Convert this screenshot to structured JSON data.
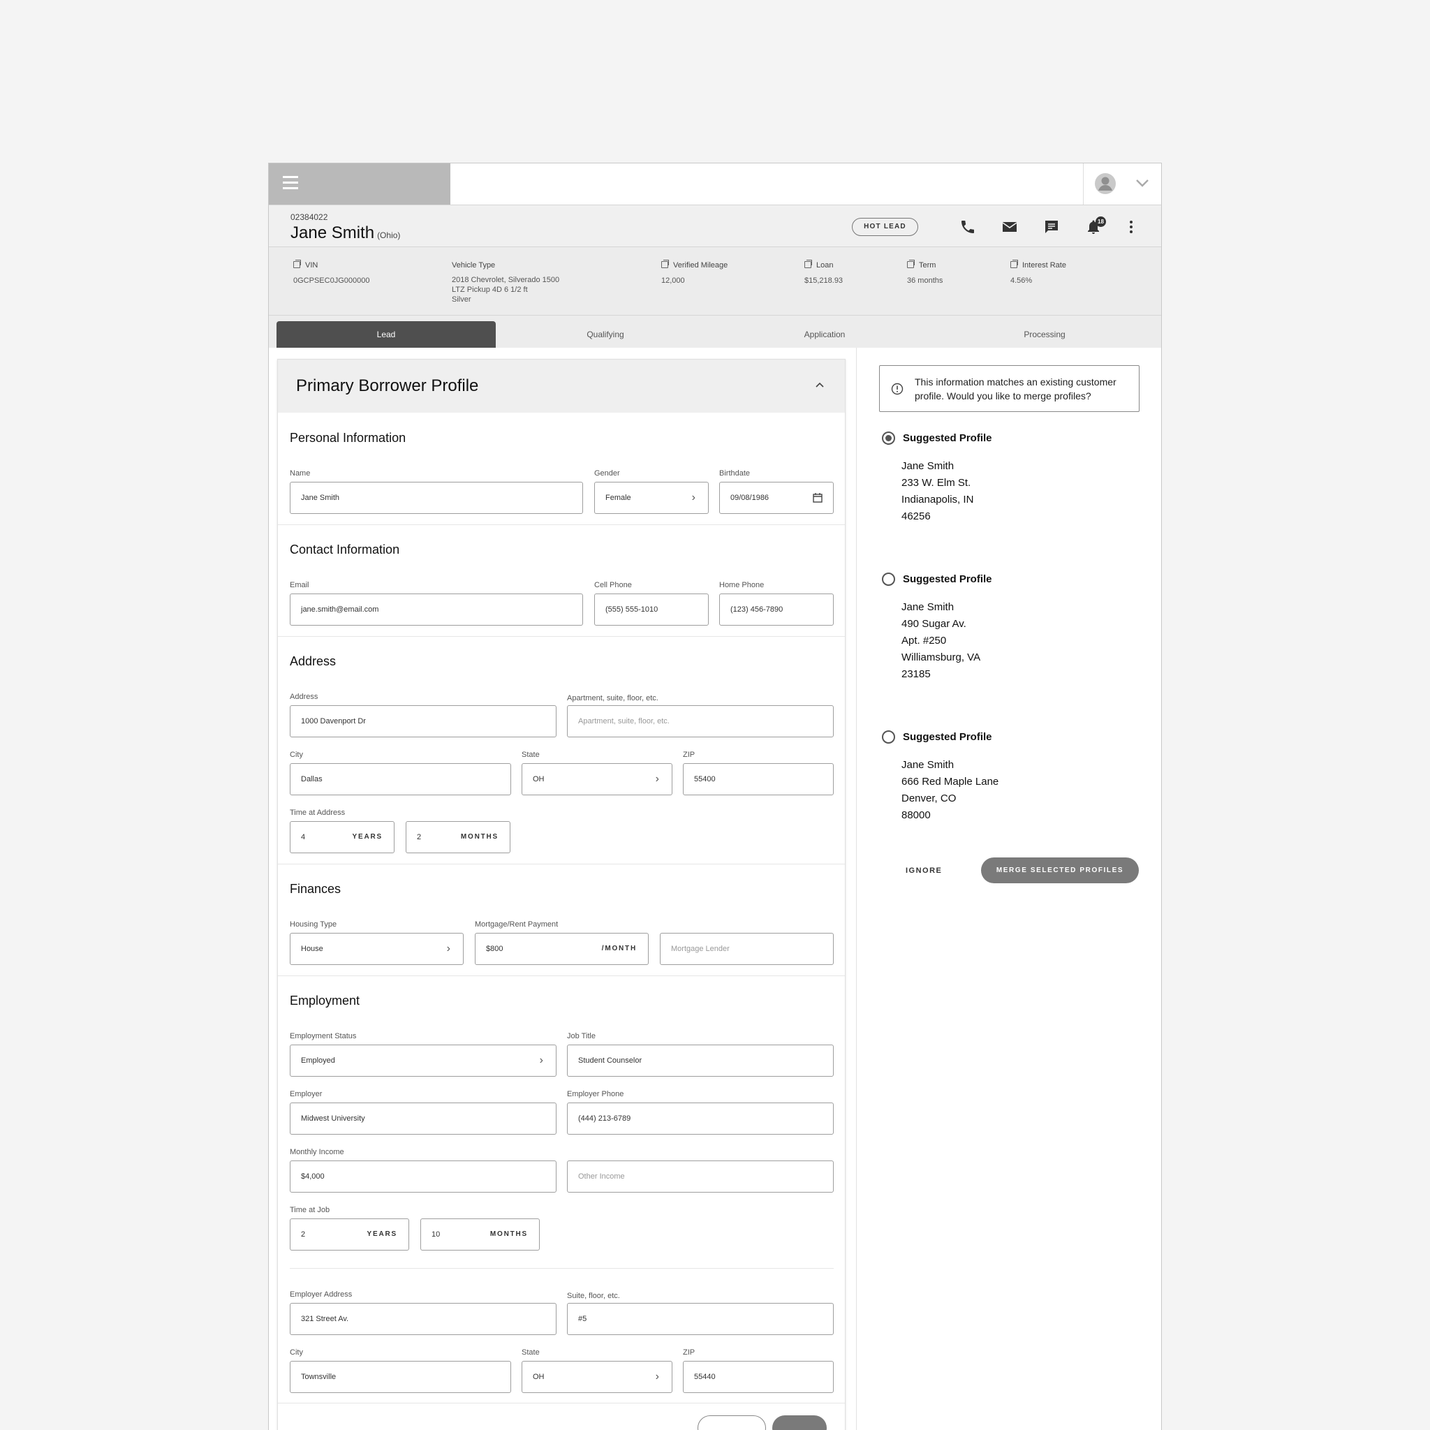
{
  "lead": {
    "id": "02384022",
    "name": "Jane Smith",
    "state": "(Ohio)",
    "badge": "HOT LEAD",
    "notification_count": "18"
  },
  "vehicle": [
    {
      "label": "VIN",
      "value": "0GCPSEC0JG000000"
    },
    {
      "label": "Vehicle Type",
      "value_lines": [
        "2018 Chevrolet, Silverado 1500",
        "LTZ Pickup 4D 6 1/2 ft",
        "Silver"
      ]
    },
    {
      "label": "Verified Mileage",
      "value": "12,000"
    },
    {
      "label": "Loan",
      "value": "$15,218.93"
    },
    {
      "label": "Term",
      "value": "36 months"
    },
    {
      "label": "Interest Rate",
      "value": "4.56%"
    }
  ],
  "tabs": [
    "Lead",
    "Qualifying",
    "Application",
    "Processing"
  ],
  "active_tab": "Lead",
  "panel": {
    "title": "Primary Borrower Profile"
  },
  "personal": {
    "heading": "Personal Information",
    "name_label": "Name",
    "name": "Jane Smith",
    "gender_label": "Gender",
    "gender": "Female",
    "birth_label": "Birthdate",
    "birth": "09/08/1986"
  },
  "contact": {
    "heading": "Contact Information",
    "email_label": "Email",
    "email": "jane.smith@email.com",
    "cell_label": "Cell Phone",
    "cell": "(555) 555-1010",
    "home_label": "Home Phone",
    "home": "(123) 456-7890"
  },
  "address": {
    "heading": "Address",
    "addr_label": "Address",
    "addr": "1000 Davenport Dr",
    "apt_label": "Apartment, suite, floor, etc.",
    "apt_placeholder": "Apartment, suite, floor, etc.",
    "city_label": "City",
    "city": "Dallas",
    "state_label": "State",
    "state": "OH",
    "zip_label": "ZIP",
    "zip": "55400",
    "time_label": "Time at Address",
    "years": "4",
    "years_unit": "YEARS",
    "months": "2",
    "months_unit": "MONTHS"
  },
  "finances": {
    "heading": "Finances",
    "housing_label": "Housing Type",
    "housing": "House",
    "payment_label": "Mortgage/Rent Payment",
    "payment": "$800",
    "payment_unit": "/MONTH",
    "lender_placeholder": "Mortgage Lender"
  },
  "employment": {
    "heading": "Employment",
    "status_label": "Employment Status",
    "status": "Employed",
    "title_label": "Job Title",
    "title": "Student Counselor",
    "employer_label": "Employer",
    "employer": "Midwest University",
    "phone_label": "Employer Phone",
    "phone": "(444) 213-6789",
    "income_label": "Monthly Income",
    "income": "$4,000",
    "other_placeholder": "Other Income",
    "time_label": "Time at Job",
    "years": "2",
    "years_unit": "YEARS",
    "months": "10",
    "months_unit": "MONTHS",
    "addr_label": "Employer Address",
    "addr": "321 Street Av.",
    "suite_label": "Suite, floor, etc.",
    "suite": "#5",
    "city_label": "City",
    "city": "Townsville",
    "state_label": "State",
    "state": "OH",
    "zip_label": "ZIP",
    "zip": "55440"
  },
  "merge": {
    "alert": "This information matches an existing customer profile. Would you like to merge profiles?",
    "profiles": [
      {
        "title": "Suggested Profile",
        "selected": true,
        "lines": [
          "Jane Smith",
          "233 W. Elm St.",
          "Indianapolis, IN",
          "46256"
        ]
      },
      {
        "title": "Suggested Profile",
        "selected": false,
        "lines": [
          "Jane Smith",
          "490 Sugar Av.",
          "Apt. #250",
          "Williamsburg, VA",
          "23185"
        ]
      },
      {
        "title": "Suggested Profile",
        "selected": false,
        "lines": [
          "Jane Smith",
          "666 Red Maple Lane",
          "Denver, CO",
          "88000"
        ]
      }
    ],
    "ignore": "IGNORE",
    "merge_button": "MERGE SELECTED PROFILES"
  }
}
